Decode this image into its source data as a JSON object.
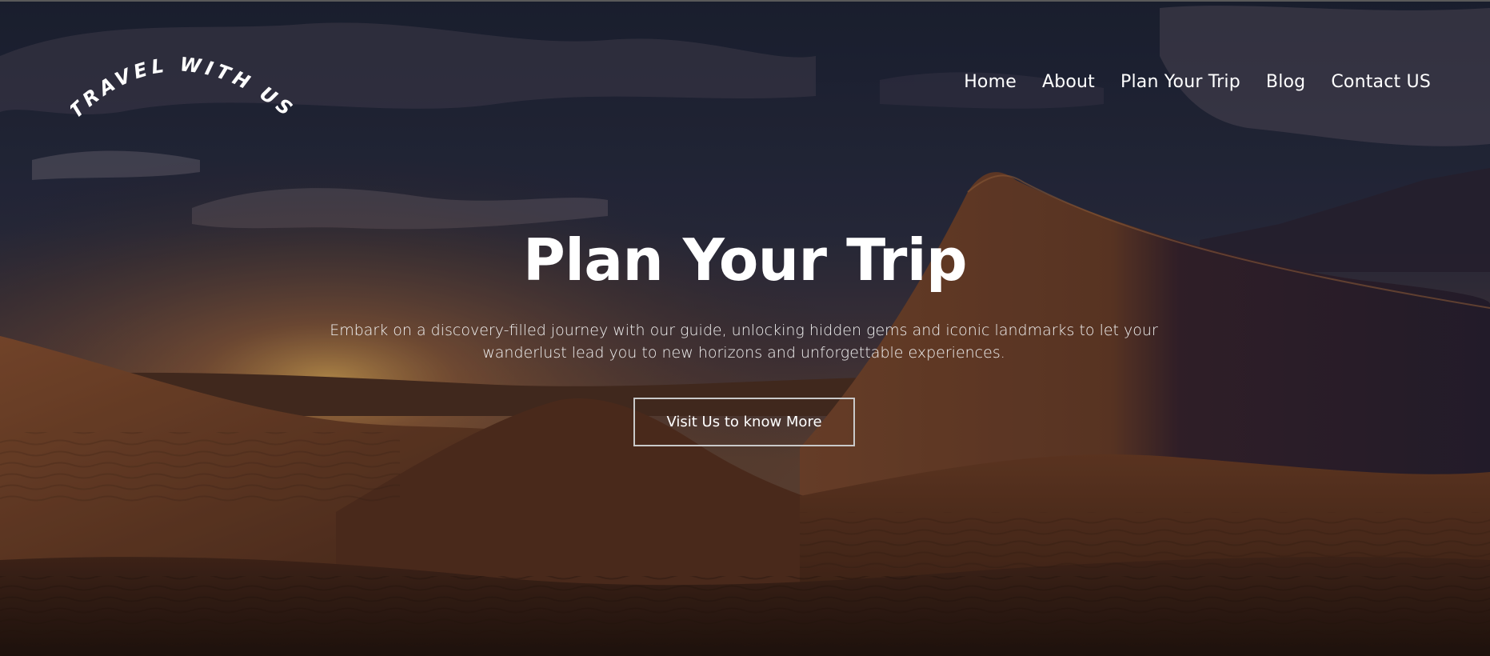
{
  "brand": {
    "logo_text": "TRAVEL WITH US"
  },
  "nav": {
    "items": [
      {
        "label": "Home"
      },
      {
        "label": "About"
      },
      {
        "label": "Plan Your Trip"
      },
      {
        "label": "Blog"
      },
      {
        "label": "Contact US"
      }
    ]
  },
  "hero": {
    "title": "Plan Your Trip",
    "subtitle": "Embark on a discovery-filled journey with our guide, unlocking hidden gems and iconic landmarks to let your wanderlust lead you to new horizons and unforgettable experiences.",
    "cta_label": "Visit Us to know More",
    "background_image": "desert-dunes-at-dusk"
  },
  "colors": {
    "text": "#ffffff",
    "button_border": "#c9c9c9",
    "sky_dark": "#1f2538",
    "sand_dark": "#3a2418",
    "sand_mid": "#6a3f26"
  }
}
